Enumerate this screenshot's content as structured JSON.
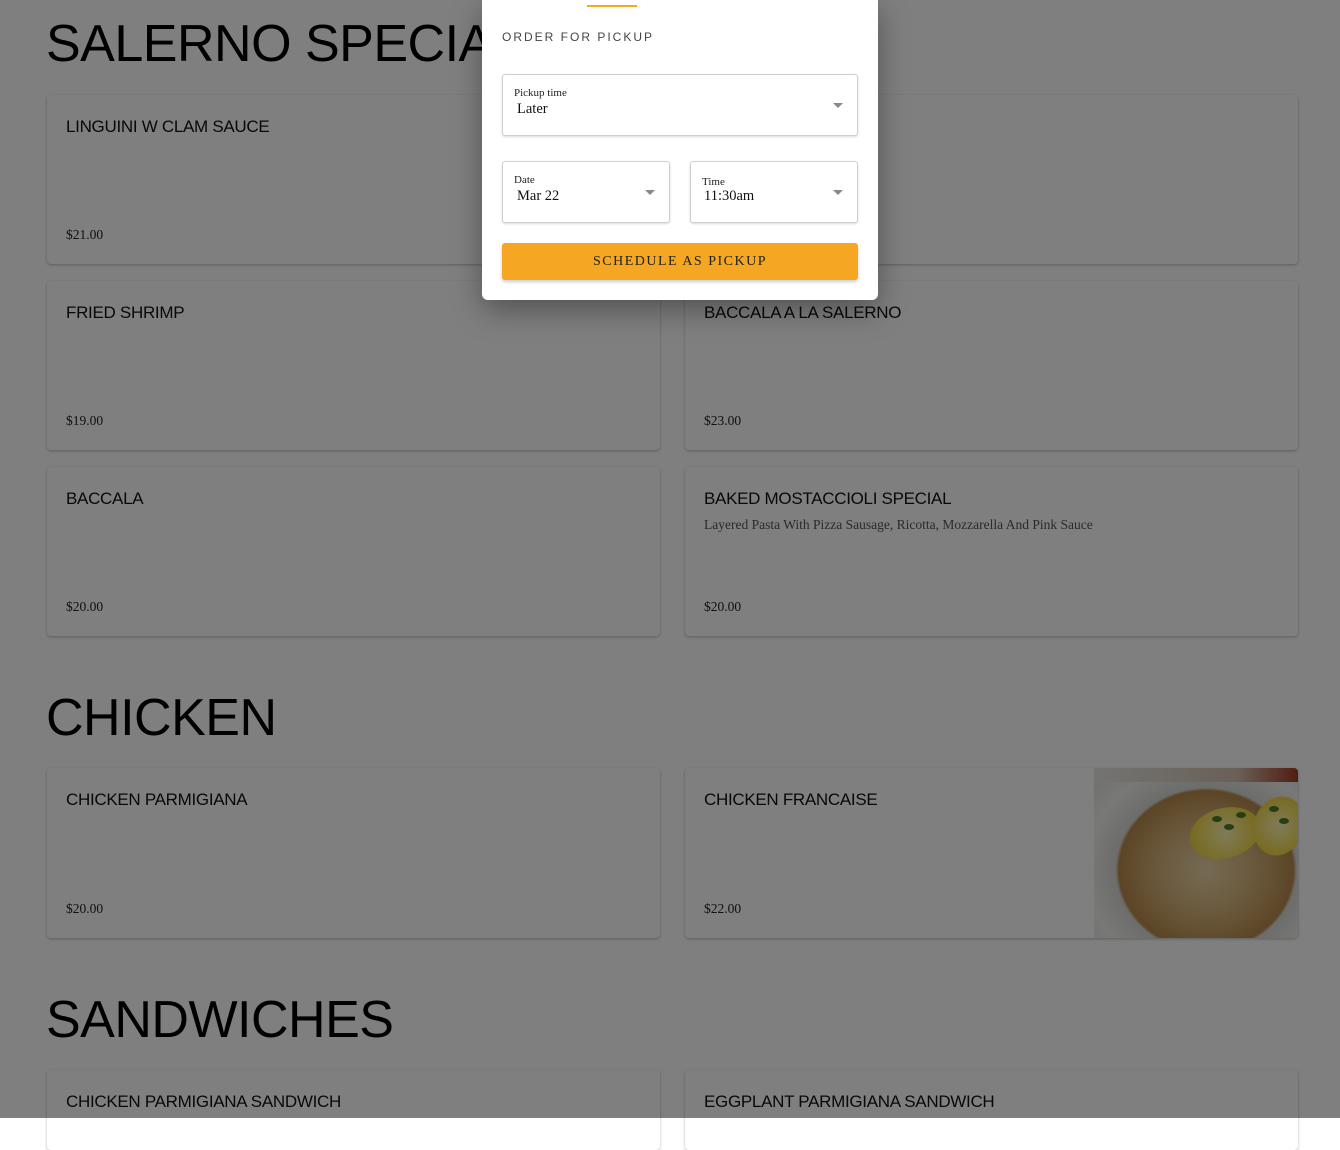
{
  "sections": [
    {
      "title": "Salerno Specialties",
      "items": [
        {
          "name": "Linguini W Clam Sauce",
          "price": "$21.00"
        },
        {
          "name": "",
          "price": ""
        },
        {
          "name": "Fried Shrimp",
          "price": "$19.00"
        },
        {
          "name": "Baccala A La Salerno",
          "price": "$23.00"
        },
        {
          "name": "Baccala",
          "price": "$20.00"
        },
        {
          "name": "Baked Mostaccioli Special",
          "description": "Layered Pasta With Pizza Sausage, Ricotta, Mozzarella And Pink Sauce",
          "price": "$20.00"
        }
      ]
    },
    {
      "title": "Chicken",
      "items": [
        {
          "name": "Chicken Parmigiana",
          "price": "$20.00"
        },
        {
          "name": "Chicken Francaise",
          "price": "$22.00",
          "image": "chicken-francaise-photo"
        }
      ]
    },
    {
      "title": "Sandwiches",
      "items": [
        {
          "name": "Chicken Parmigiana Sandwich"
        },
        {
          "name": "Eggplant Parmigiana Sandwich"
        }
      ]
    }
  ],
  "modal": {
    "heading": "Order for pickup",
    "pickup_time": {
      "label": "Pickup time",
      "value": "Later"
    },
    "date": {
      "label": "Date",
      "value": "Mar 22"
    },
    "time": {
      "label": "Time",
      "value": "11:30am"
    },
    "submit_label": "Schedule as pickup"
  },
  "colors": {
    "accent": "#f5a623",
    "overlay": "rgba(0,0,0,0.5)"
  }
}
